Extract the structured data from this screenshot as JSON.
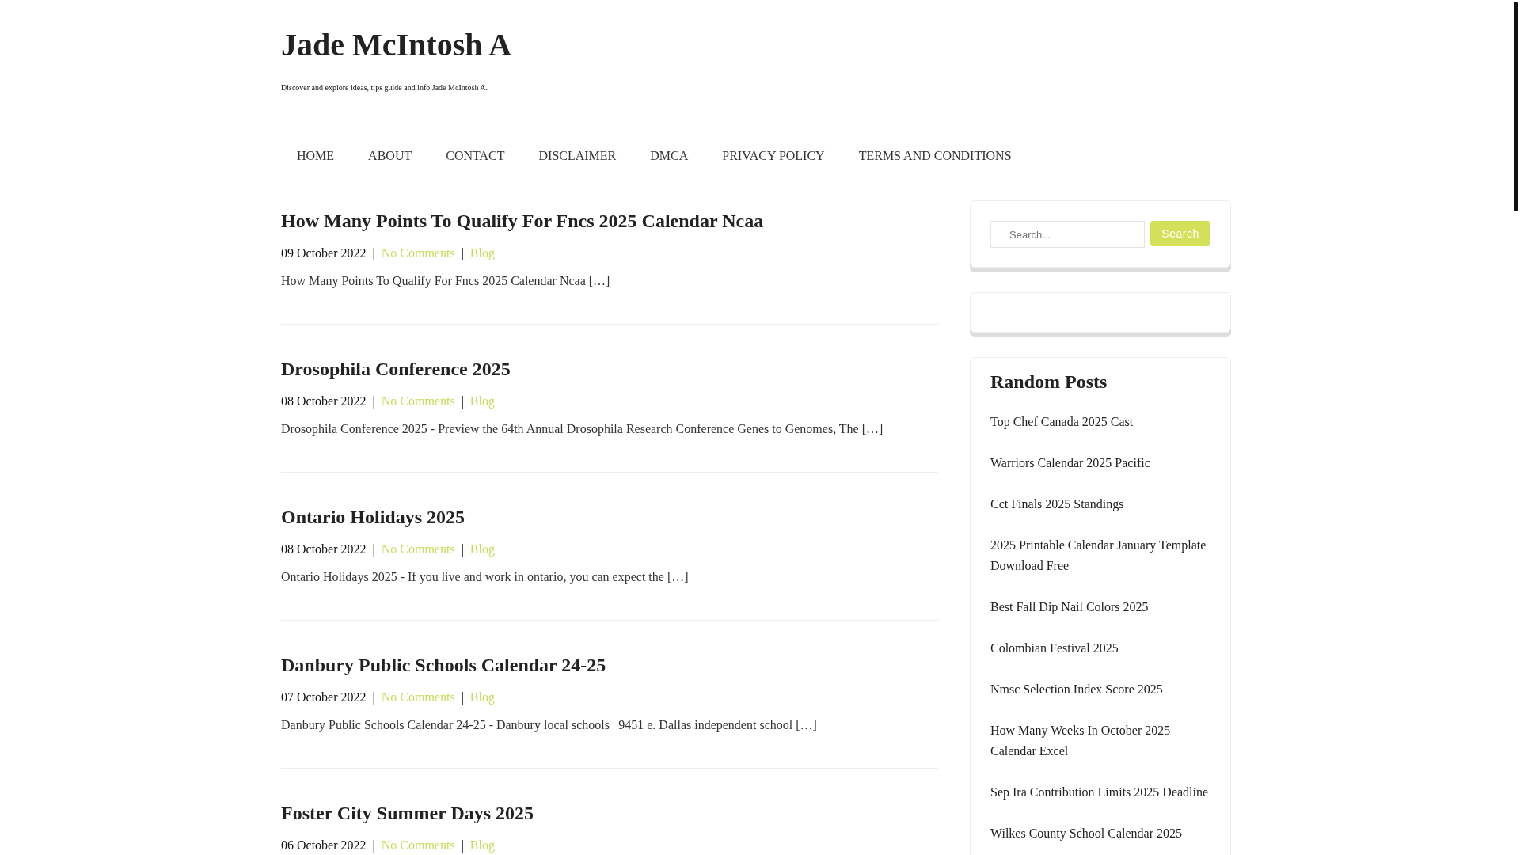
{
  "site": {
    "title": "Jade McIntosh A",
    "tagline": "Discover and explore ideas, tips guide and info Jade McIntosh A."
  },
  "nav": [
    "HOME",
    "ABOUT",
    "CONTACT",
    "DISCLAIMER",
    "DMCA",
    "PRIVACY POLICY",
    "TERMS AND CONDITIONS"
  ],
  "posts": [
    {
      "title": "How Many Points To Qualify For Fncs 2025 Calendar Ncaa",
      "meta": [
        {
          "kind": "date",
          "text": "09 October 2022"
        },
        {
          "kind": "separator",
          "text": "|"
        },
        {
          "kind": "comments_link",
          "text": "No Comments"
        },
        {
          "kind": "separator",
          "text": "|"
        },
        {
          "kind": "category_link",
          "text": "Blog"
        }
      ],
      "excerpt": "How Many Points To Qualify For Fncs 2025 Calendar Ncaa […]"
    },
    {
      "title": "Drosophila Conference 2025",
      "meta": [
        {
          "kind": "date",
          "text": "08 October 2022"
        },
        {
          "kind": "separator",
          "text": "|"
        },
        {
          "kind": "comments_link",
          "text": "No Comments"
        },
        {
          "kind": "separator",
          "text": "|"
        },
        {
          "kind": "category_link",
          "text": "Blog"
        }
      ],
      "excerpt": "Drosophila Conference 2025 - Preview the 64th Annual Drosophila Research Conference Genes to Genomes, The […]"
    },
    {
      "title": "Ontario Holidays 2025",
      "meta": [
        {
          "kind": "date",
          "text": "08 October 2022"
        },
        {
          "kind": "separator",
          "text": "|"
        },
        {
          "kind": "comments_link",
          "text": "No Comments"
        },
        {
          "kind": "separator",
          "text": "|"
        },
        {
          "kind": "category_link",
          "text": "Blog"
        }
      ],
      "excerpt": "Ontario Holidays 2025 - If you live and work in ontario, you can expect the […]"
    },
    {
      "title": "Danbury Public Schools Calendar 24-25",
      "meta": [
        {
          "kind": "date",
          "text": "07 October 2022"
        },
        {
          "kind": "separator",
          "text": "|"
        },
        {
          "kind": "comments_link",
          "text": "No Comments"
        },
        {
          "kind": "separator",
          "text": "|"
        },
        {
          "kind": "category_link",
          "text": "Blog"
        }
      ],
      "excerpt": "Danbury Public Schools Calendar 24-25 - Danbury local schools | 9451 e. Dallas independent school […]"
    },
    {
      "title": "Foster City Summer Days 2025",
      "meta": [
        {
          "kind": "date",
          "text": "06 October 2022"
        },
        {
          "kind": "separator",
          "text": "|"
        },
        {
          "kind": "comments_link",
          "text": "No Comments"
        },
        {
          "kind": "separator",
          "text": "|"
        },
        {
          "kind": "category_link",
          "text": "Blog"
        }
      ]
    }
  ],
  "sidebar": {
    "search": {
      "placeholder": "Search...",
      "button": "Search"
    },
    "random_posts": {
      "title": "Random Posts",
      "items": [
        "Top Chef Canada 2025 Cast",
        "Warriors Calendar 2025 Pacific",
        "Cct Finals 2025 Standings",
        "2025 Printable Calendar January Template Download Free",
        "Best Fall Dip Nail Colors 2025",
        "Colombian Festival 2025",
        "Nmsc Selection Index Score 2025",
        "How Many Weeks In October 2025 Calendar Excel",
        "Sep Ira Contribution Limits 2025 Deadline",
        "Wilkes County School Calendar 2025"
      ]
    }
  }
}
